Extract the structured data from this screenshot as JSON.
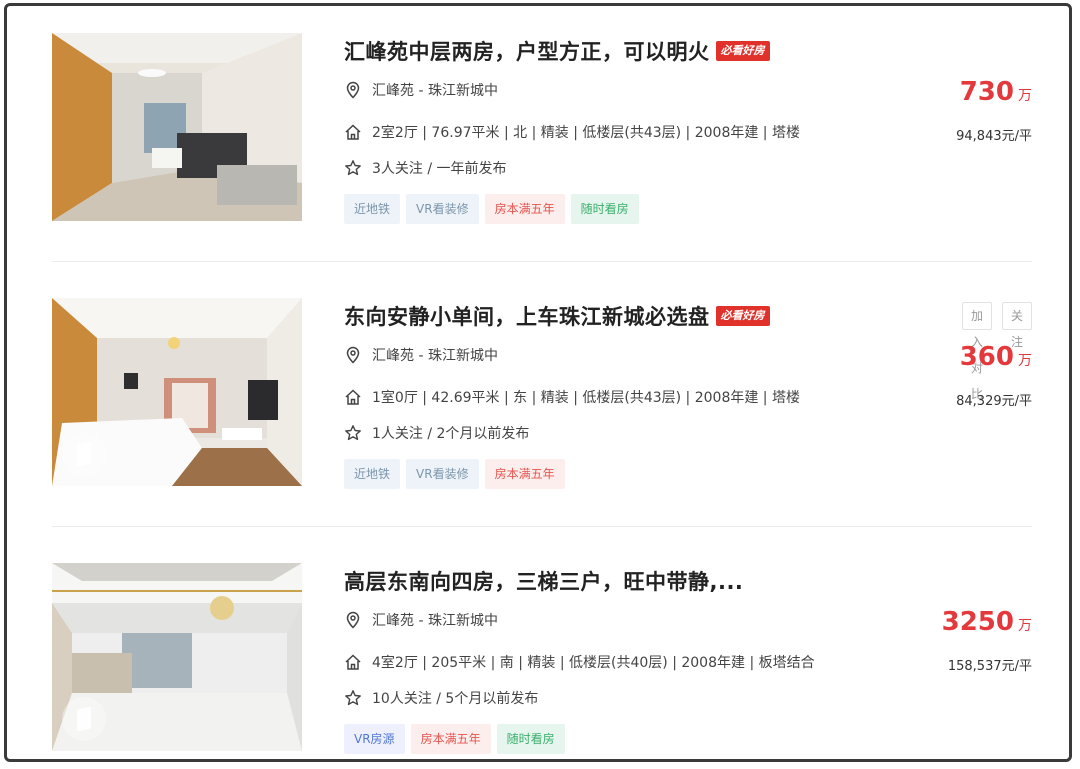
{
  "listings": [
    {
      "title": "汇峰苑中层两房，户型方正，可以明火",
      "badge": "必看好房",
      "location": "汇峰苑 - 珠江新城中",
      "details": "2室2厅 | 76.97平米 | 北 | 精装 | 低楼层(共43层) | 2008年建 | 塔楼",
      "follow": "3人关注 / 一年前发布",
      "tags": [
        "近地铁",
        "VR看装修",
        "房本满五年",
        "随时看房"
      ],
      "total_price": "730",
      "price_unit": "万",
      "unit_price": "94,843元/平"
    },
    {
      "title": "东向安静小单间，上车珠江新城必选盘",
      "badge": "必看好房",
      "location": "汇峰苑 - 珠江新城中",
      "details": "1室0厅 | 42.69平米 | 东 | 精装 | 低楼层(共43层) | 2008年建 | 塔楼",
      "follow": "1人关注 / 2个月以前发布",
      "tags": [
        "近地铁",
        "VR看装修",
        "房本满五年"
      ],
      "total_price": "360",
      "price_unit": "万",
      "unit_price": "84,329元/平",
      "actions": {
        "compare": "加入对比",
        "follow": "关注"
      }
    },
    {
      "title": "高层东南向四房，三梯三户，旺中带静,...",
      "location": "汇峰苑 - 珠江新城中",
      "details": "4室2厅 | 205平米 | 南 | 精装 | 低楼层(共40层) | 2008年建 | 板塔结合",
      "follow": "10人关注 / 5个月以前发布",
      "tags": [
        "VR房源",
        "房本满五年",
        "随时看房"
      ],
      "total_price": "3250",
      "price_unit": "万",
      "unit_price": "158,537元/平"
    }
  ],
  "colors": {
    "price": "#e4393c",
    "badge": "#e0322b"
  }
}
